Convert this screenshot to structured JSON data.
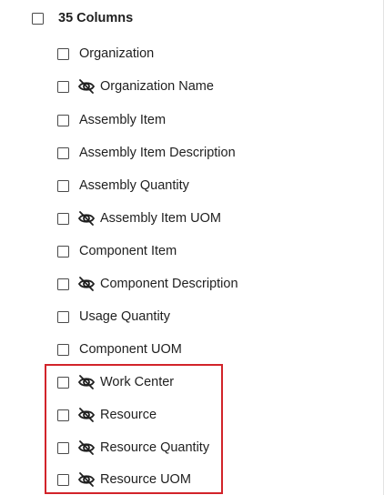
{
  "header": {
    "label": "35 Columns"
  },
  "columns": [
    {
      "label": "Organization",
      "hidden": false
    },
    {
      "label": "Organization Name",
      "hidden": true
    },
    {
      "label": "Assembly Item",
      "hidden": false
    },
    {
      "label": "Assembly Item Description",
      "hidden": false
    },
    {
      "label": "Assembly Quantity",
      "hidden": false
    },
    {
      "label": "Assembly Item UOM",
      "hidden": true
    },
    {
      "label": "Component Item",
      "hidden": false
    },
    {
      "label": "Component Description",
      "hidden": true
    },
    {
      "label": "Usage Quantity",
      "hidden": false
    },
    {
      "label": "Component UOM",
      "hidden": false
    },
    {
      "label": "Work Center",
      "hidden": true
    },
    {
      "label": "Resource",
      "hidden": true
    },
    {
      "label": "Resource Quantity",
      "hidden": true
    },
    {
      "label": "Resource UOM",
      "hidden": true
    }
  ],
  "icons": {
    "hidden_indicator": "eye-slash-icon"
  },
  "colors": {
    "highlight": "#d2232a"
  }
}
